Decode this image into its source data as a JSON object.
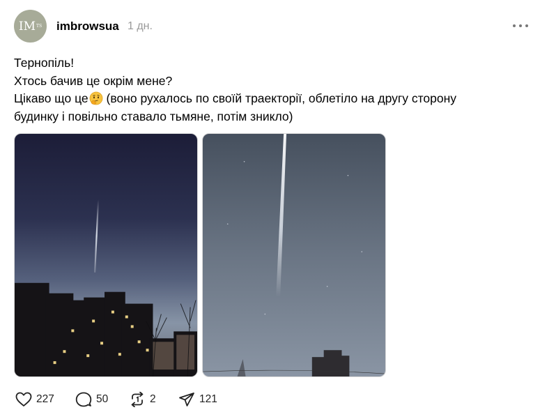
{
  "post": {
    "avatar_initials": "IM",
    "avatar_sub": "TS",
    "username": "imbrowsua",
    "time": "1 дн.",
    "text_lines": [
      "Тернопіль!",
      "Хтось бачив це окрім мене?",
      "Цікаво що це",
      " (воно рухалось по своїй траекторії, облетіло на другу сторону",
      "будинку і повільно ставало тьмяне, потім зникло)"
    ],
    "images": [
      "photo-night-sky-buildings",
      "photo-sky-streak"
    ]
  },
  "actions": {
    "likes": "227",
    "replies": "50",
    "reposts": "2",
    "shares": "121"
  },
  "colors": {
    "avatar_bg": "#a7ab98",
    "muted": "#999999"
  },
  "icons": [
    "heart-icon",
    "comment-icon",
    "repost-icon",
    "send-icon",
    "more-icon",
    "thinking-face-emoji"
  ]
}
